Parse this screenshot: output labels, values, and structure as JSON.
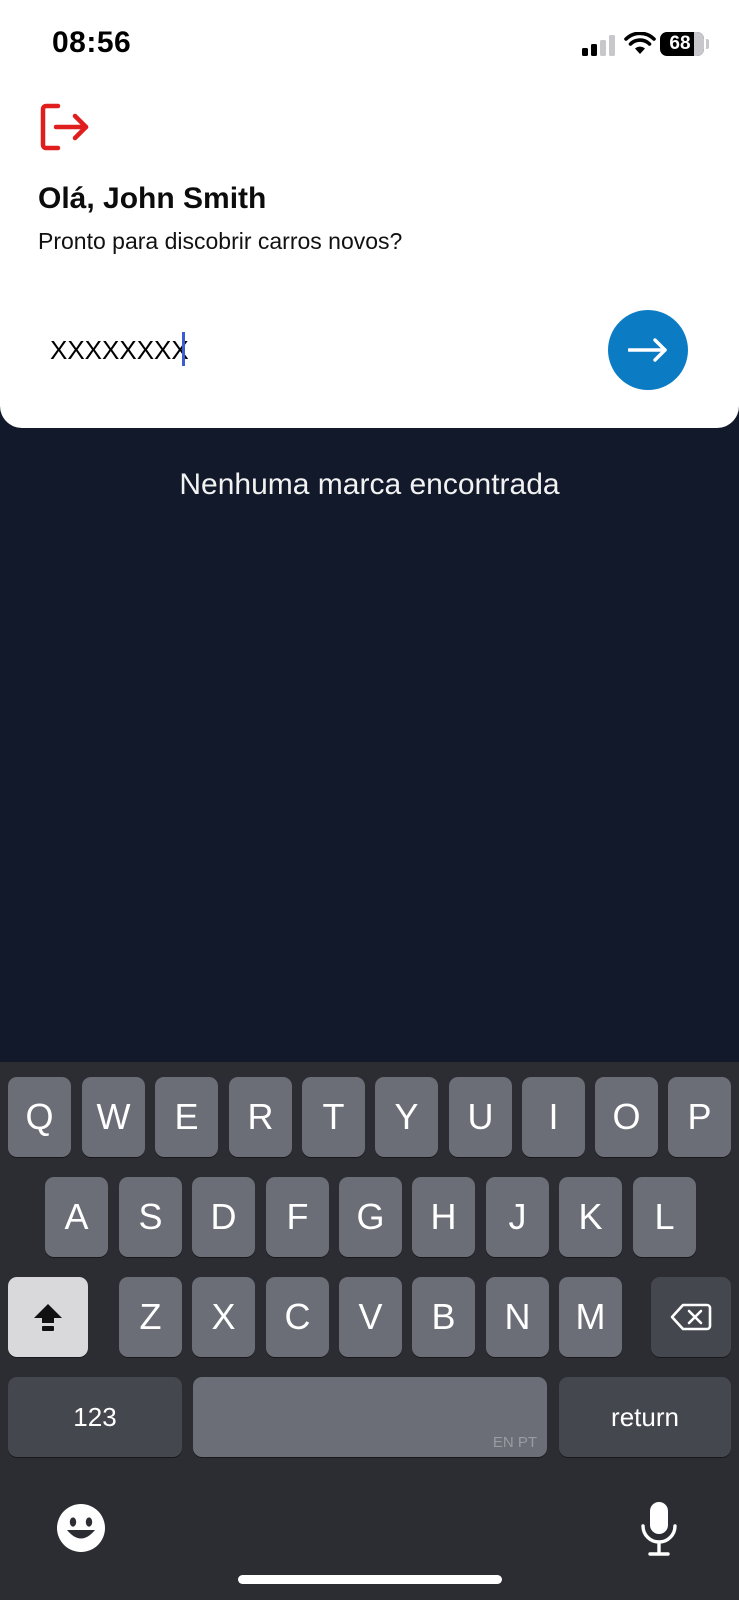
{
  "status_bar": {
    "time": "08:56",
    "battery": "68"
  },
  "header": {
    "greeting": "Olá, John Smith",
    "subtitle": "Pronto para discobrir carros novos?"
  },
  "search": {
    "value": "XXXXXXXX"
  },
  "empty_state": {
    "message": "Nenhuma marca encontrada"
  },
  "keyboard": {
    "row1": [
      "Q",
      "W",
      "E",
      "R",
      "T",
      "Y",
      "U",
      "I",
      "O",
      "P"
    ],
    "row2": [
      "A",
      "S",
      "D",
      "F",
      "G",
      "H",
      "J",
      "K",
      "L"
    ],
    "row3": [
      "Z",
      "X",
      "C",
      "V",
      "B",
      "N",
      "M"
    ],
    "numbers_label": "123",
    "space_language": "EN PT",
    "return_label": "return"
  },
  "icons": {
    "logout": "logout-icon",
    "submit": "arrow-right-icon",
    "shift": "shift-icon",
    "backspace": "backspace-icon",
    "emoji": "emoji-icon",
    "mic": "microphone-icon"
  },
  "colors": {
    "accent": "#0b7cc4",
    "logout": "#e01e1e",
    "background": "#12192a",
    "caret": "#3e5bd6"
  }
}
